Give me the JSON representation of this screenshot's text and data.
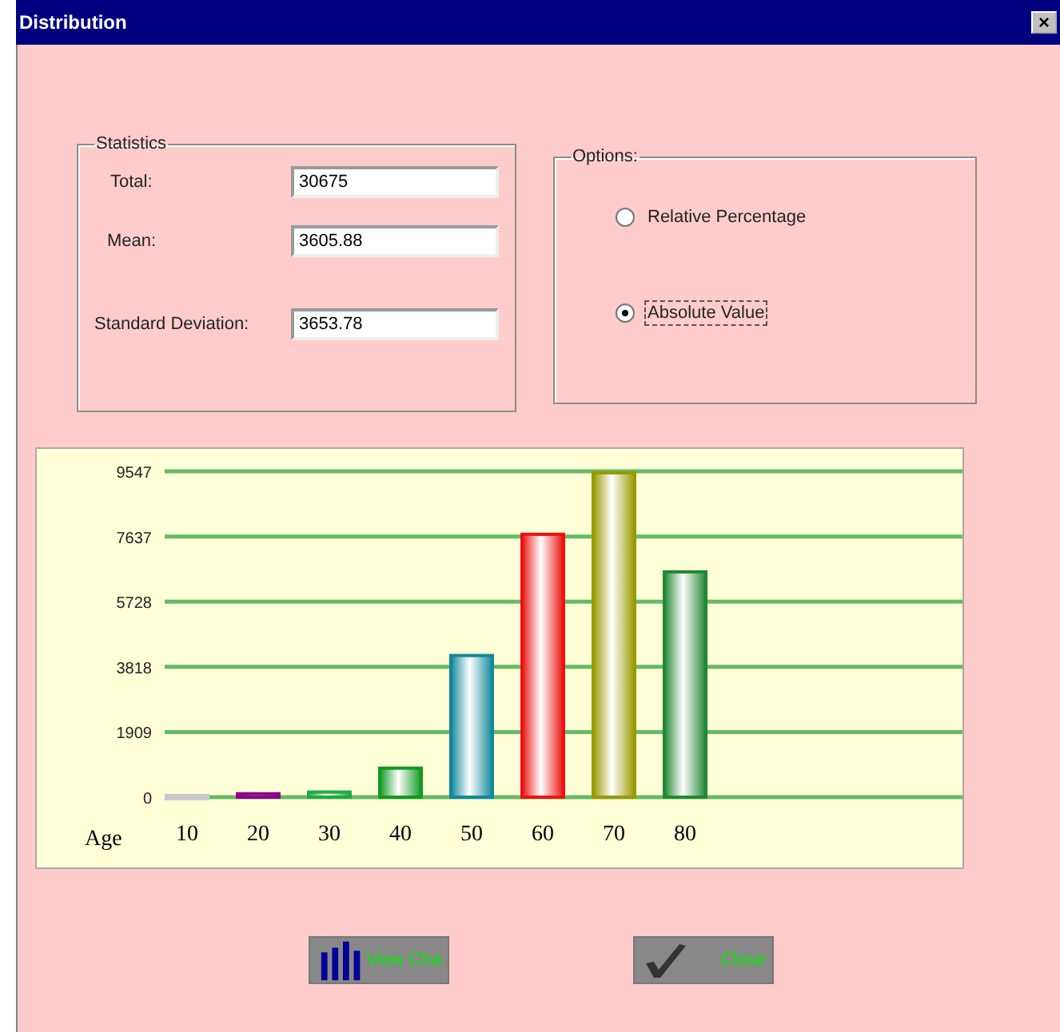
{
  "window": {
    "title": "Distribution",
    "close": "×"
  },
  "statistics": {
    "title": "Statistics",
    "fields": [
      {
        "label": "Total:",
        "value": "30675"
      },
      {
        "label": "Mean:",
        "value": "3605.88"
      },
      {
        "label": "Standard Deviation:",
        "value": "3653.78"
      }
    ]
  },
  "options": {
    "title": "Options:",
    "radios": [
      {
        "label": "Relative Percentage",
        "selected": false
      },
      {
        "label": "Absolute Value",
        "selected": true
      }
    ]
  },
  "chart": {
    "chart_data": {
      "type": "bar",
      "xlabel": "Age",
      "categories": [
        "10",
        "20",
        "30",
        "40",
        "50",
        "60",
        "70",
        "80"
      ],
      "stacked": true,
      "grid": true,
      "series": [
        {
          "color": "#c8c8c8",
          "values": [
            50,
            null,
            null,
            null,
            null,
            null,
            null,
            null
          ]
        },
        {
          "color": "#8b008b",
          "values": [
            null,
            100,
            null,
            null,
            null,
            null,
            null,
            null
          ]
        },
        {
          "color": "#22aa44",
          "values": [
            null,
            null,
            150,
            null,
            null,
            null,
            null,
            null
          ]
        },
        {
          "color": "#119922",
          "values": [
            null,
            null,
            null,
            850,
            null,
            null,
            null,
            null
          ]
        },
        {
          "color": "#118899",
          "values": [
            null,
            null,
            null,
            null,
            4150,
            null,
            null,
            null
          ]
        },
        {
          "color": "#ee1111",
          "values": [
            null,
            null,
            null,
            null,
            null,
            7700,
            null,
            null
          ]
        },
        {
          "color": "#999900",
          "values": [
            null,
            null,
            null,
            null,
            null,
            null,
            9500,
            null
          ]
        },
        {
          "color": "#228833",
          "values": [
            null,
            null,
            null,
            null,
            null,
            null,
            null,
            6600
          ]
        }
      ],
      "ylim": [
        0,
        9547
      ],
      "yticks": [
        0,
        1909,
        3818,
        5728,
        7637,
        9547
      ]
    }
  },
  "buttons": [
    {
      "kind": "chart",
      "label": "View Cha"
    },
    {
      "kind": "check",
      "label": "Close"
    }
  ]
}
